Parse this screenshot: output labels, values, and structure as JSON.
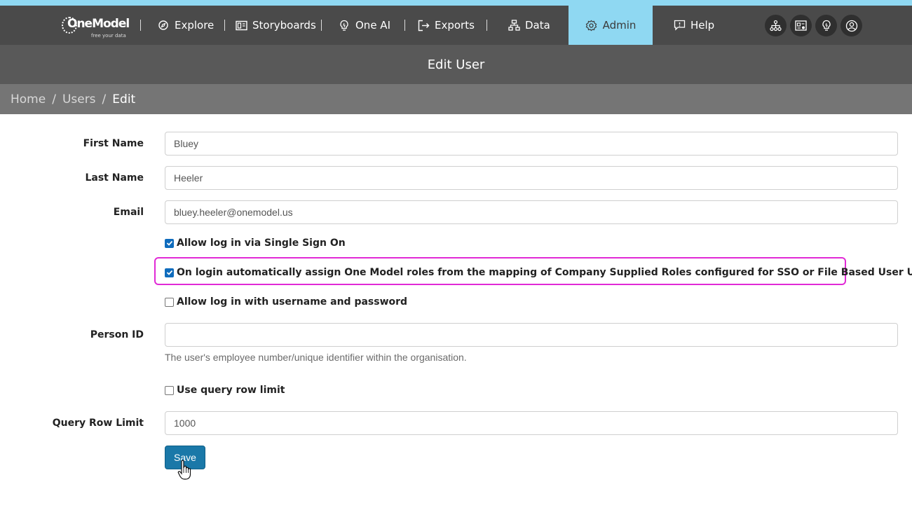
{
  "app": {
    "brand": "OneModel",
    "tagline": "free your data"
  },
  "nav": {
    "items": [
      {
        "label": "Explore",
        "icon": "explore-icon"
      },
      {
        "label": "Storyboards",
        "icon": "storyboards-icon"
      },
      {
        "label": "One AI",
        "icon": "lightbulb-icon"
      },
      {
        "label": "Exports",
        "icon": "export-icon"
      },
      {
        "label": "Data",
        "icon": "data-icon"
      },
      {
        "label": "Admin",
        "icon": "gear-icon",
        "active": true
      },
      {
        "label": "Help",
        "icon": "help-icon"
      }
    ],
    "right_icons": [
      "org-chart-icon",
      "dashboard-icon",
      "lightbulb-icon",
      "user-icon"
    ],
    "colors": {
      "bar": "#4a4a4a",
      "active": "#8fd8f2"
    }
  },
  "page": {
    "title": "Edit User"
  },
  "breadcrumb": [
    "Home",
    "Users",
    "Edit"
  ],
  "form": {
    "first_name_label": "First Name",
    "first_name_value": "Bluey",
    "last_name_label": "Last Name",
    "last_name_value": "Heeler",
    "email_label": "Email",
    "email_value": "bluey.heeler@onemodel.us",
    "sso_label": "Allow log in via Single Sign On",
    "sso_checked": true,
    "auto_roles_label": "On login automatically assign One Model roles from the mapping of Company Supplied Roles configured for SSO or File Based User Upload",
    "auto_roles_checked": true,
    "password_login_label": "Allow log in with username and password",
    "password_login_checked": false,
    "person_id_label": "Person ID",
    "person_id_value": "",
    "person_id_help": "The user's employee number/unique identifier within the organisation.",
    "row_limit_toggle_label": "Use query row limit",
    "row_limit_toggle_checked": false,
    "row_limit_label": "Query Row Limit",
    "row_limit_value": "1000",
    "save_label": "Save",
    "highlight_color": "#e12ad6",
    "save_color": "#1a78a8"
  }
}
